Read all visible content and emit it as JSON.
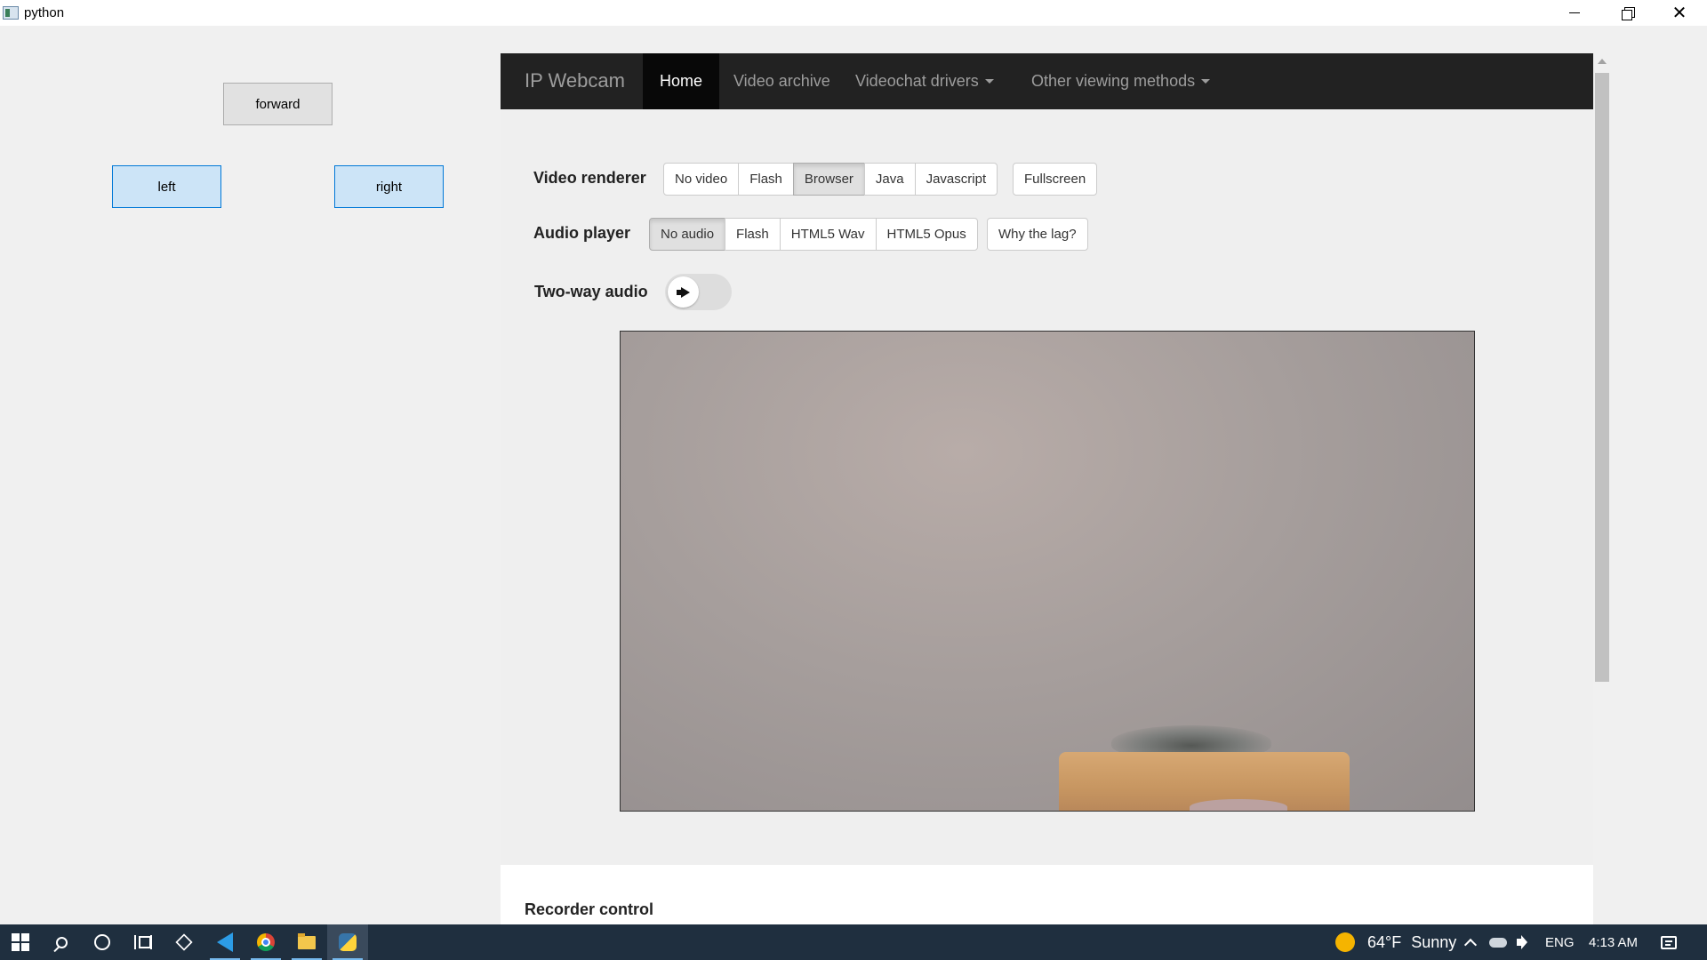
{
  "window": {
    "title": "python"
  },
  "controls": {
    "forward": "forward",
    "left": "left",
    "right": "right"
  },
  "webcam": {
    "navbar": {
      "brand": "IP Webcam",
      "items": [
        {
          "label": "Home",
          "active": true,
          "dropdown": false
        },
        {
          "label": "Video archive",
          "active": false,
          "dropdown": false
        },
        {
          "label": "Videochat drivers",
          "active": false,
          "dropdown": true
        },
        {
          "label": "Other viewing methods",
          "active": false,
          "dropdown": true
        }
      ]
    },
    "video_renderer": {
      "label": "Video renderer",
      "options": [
        "No video",
        "Flash",
        "Browser",
        "Java",
        "Javascript"
      ],
      "selected": "Browser",
      "extra": "Fullscreen"
    },
    "audio_player": {
      "label": "Audio player",
      "options": [
        "No audio",
        "Flash",
        "HTML5 Wav",
        "HTML5 Opus"
      ],
      "selected": "No audio",
      "extra": "Why the lag?"
    },
    "two_way_audio": {
      "label": "Two-way audio",
      "enabled": false,
      "icon": "megaphone-icon"
    },
    "recorder_control": {
      "title": "Recorder control"
    }
  },
  "taskbar": {
    "icons": [
      "windows-start-icon",
      "search-icon",
      "cortana-icon",
      "task-view-icon",
      "3d-viewer-icon",
      "vscode-icon",
      "chrome-icon",
      "file-explorer-icon",
      "python-icon"
    ],
    "weather": {
      "temp": "64°F",
      "condition": "Sunny"
    },
    "language": "ENG",
    "time": "4:13 AM"
  }
}
